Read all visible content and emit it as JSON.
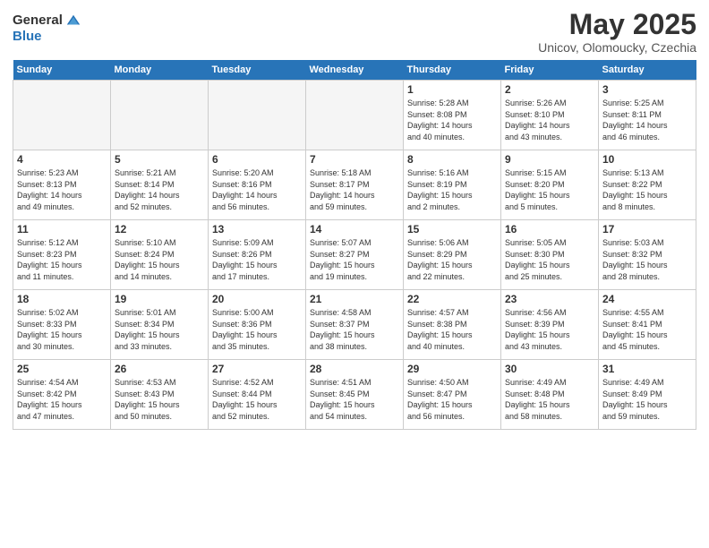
{
  "header": {
    "logo_general": "General",
    "logo_blue": "Blue",
    "month": "May 2025",
    "location": "Unicov, Olomoucky, Czechia"
  },
  "days_of_week": [
    "Sunday",
    "Monday",
    "Tuesday",
    "Wednesday",
    "Thursday",
    "Friday",
    "Saturday"
  ],
  "weeks": [
    [
      {
        "day": "",
        "info": ""
      },
      {
        "day": "",
        "info": ""
      },
      {
        "day": "",
        "info": ""
      },
      {
        "day": "",
        "info": ""
      },
      {
        "day": "1",
        "info": "Sunrise: 5:28 AM\nSunset: 8:08 PM\nDaylight: 14 hours\nand 40 minutes."
      },
      {
        "day": "2",
        "info": "Sunrise: 5:26 AM\nSunset: 8:10 PM\nDaylight: 14 hours\nand 43 minutes."
      },
      {
        "day": "3",
        "info": "Sunrise: 5:25 AM\nSunset: 8:11 PM\nDaylight: 14 hours\nand 46 minutes."
      }
    ],
    [
      {
        "day": "4",
        "info": "Sunrise: 5:23 AM\nSunset: 8:13 PM\nDaylight: 14 hours\nand 49 minutes."
      },
      {
        "day": "5",
        "info": "Sunrise: 5:21 AM\nSunset: 8:14 PM\nDaylight: 14 hours\nand 52 minutes."
      },
      {
        "day": "6",
        "info": "Sunrise: 5:20 AM\nSunset: 8:16 PM\nDaylight: 14 hours\nand 56 minutes."
      },
      {
        "day": "7",
        "info": "Sunrise: 5:18 AM\nSunset: 8:17 PM\nDaylight: 14 hours\nand 59 minutes."
      },
      {
        "day": "8",
        "info": "Sunrise: 5:16 AM\nSunset: 8:19 PM\nDaylight: 15 hours\nand 2 minutes."
      },
      {
        "day": "9",
        "info": "Sunrise: 5:15 AM\nSunset: 8:20 PM\nDaylight: 15 hours\nand 5 minutes."
      },
      {
        "day": "10",
        "info": "Sunrise: 5:13 AM\nSunset: 8:22 PM\nDaylight: 15 hours\nand 8 minutes."
      }
    ],
    [
      {
        "day": "11",
        "info": "Sunrise: 5:12 AM\nSunset: 8:23 PM\nDaylight: 15 hours\nand 11 minutes."
      },
      {
        "day": "12",
        "info": "Sunrise: 5:10 AM\nSunset: 8:24 PM\nDaylight: 15 hours\nand 14 minutes."
      },
      {
        "day": "13",
        "info": "Sunrise: 5:09 AM\nSunset: 8:26 PM\nDaylight: 15 hours\nand 17 minutes."
      },
      {
        "day": "14",
        "info": "Sunrise: 5:07 AM\nSunset: 8:27 PM\nDaylight: 15 hours\nand 19 minutes."
      },
      {
        "day": "15",
        "info": "Sunrise: 5:06 AM\nSunset: 8:29 PM\nDaylight: 15 hours\nand 22 minutes."
      },
      {
        "day": "16",
        "info": "Sunrise: 5:05 AM\nSunset: 8:30 PM\nDaylight: 15 hours\nand 25 minutes."
      },
      {
        "day": "17",
        "info": "Sunrise: 5:03 AM\nSunset: 8:32 PM\nDaylight: 15 hours\nand 28 minutes."
      }
    ],
    [
      {
        "day": "18",
        "info": "Sunrise: 5:02 AM\nSunset: 8:33 PM\nDaylight: 15 hours\nand 30 minutes."
      },
      {
        "day": "19",
        "info": "Sunrise: 5:01 AM\nSunset: 8:34 PM\nDaylight: 15 hours\nand 33 minutes."
      },
      {
        "day": "20",
        "info": "Sunrise: 5:00 AM\nSunset: 8:36 PM\nDaylight: 15 hours\nand 35 minutes."
      },
      {
        "day": "21",
        "info": "Sunrise: 4:58 AM\nSunset: 8:37 PM\nDaylight: 15 hours\nand 38 minutes."
      },
      {
        "day": "22",
        "info": "Sunrise: 4:57 AM\nSunset: 8:38 PM\nDaylight: 15 hours\nand 40 minutes."
      },
      {
        "day": "23",
        "info": "Sunrise: 4:56 AM\nSunset: 8:39 PM\nDaylight: 15 hours\nand 43 minutes."
      },
      {
        "day": "24",
        "info": "Sunrise: 4:55 AM\nSunset: 8:41 PM\nDaylight: 15 hours\nand 45 minutes."
      }
    ],
    [
      {
        "day": "25",
        "info": "Sunrise: 4:54 AM\nSunset: 8:42 PM\nDaylight: 15 hours\nand 47 minutes."
      },
      {
        "day": "26",
        "info": "Sunrise: 4:53 AM\nSunset: 8:43 PM\nDaylight: 15 hours\nand 50 minutes."
      },
      {
        "day": "27",
        "info": "Sunrise: 4:52 AM\nSunset: 8:44 PM\nDaylight: 15 hours\nand 52 minutes."
      },
      {
        "day": "28",
        "info": "Sunrise: 4:51 AM\nSunset: 8:45 PM\nDaylight: 15 hours\nand 54 minutes."
      },
      {
        "day": "29",
        "info": "Sunrise: 4:50 AM\nSunset: 8:47 PM\nDaylight: 15 hours\nand 56 minutes."
      },
      {
        "day": "30",
        "info": "Sunrise: 4:49 AM\nSunset: 8:48 PM\nDaylight: 15 hours\nand 58 minutes."
      },
      {
        "day": "31",
        "info": "Sunrise: 4:49 AM\nSunset: 8:49 PM\nDaylight: 15 hours\nand 59 minutes."
      }
    ]
  ]
}
